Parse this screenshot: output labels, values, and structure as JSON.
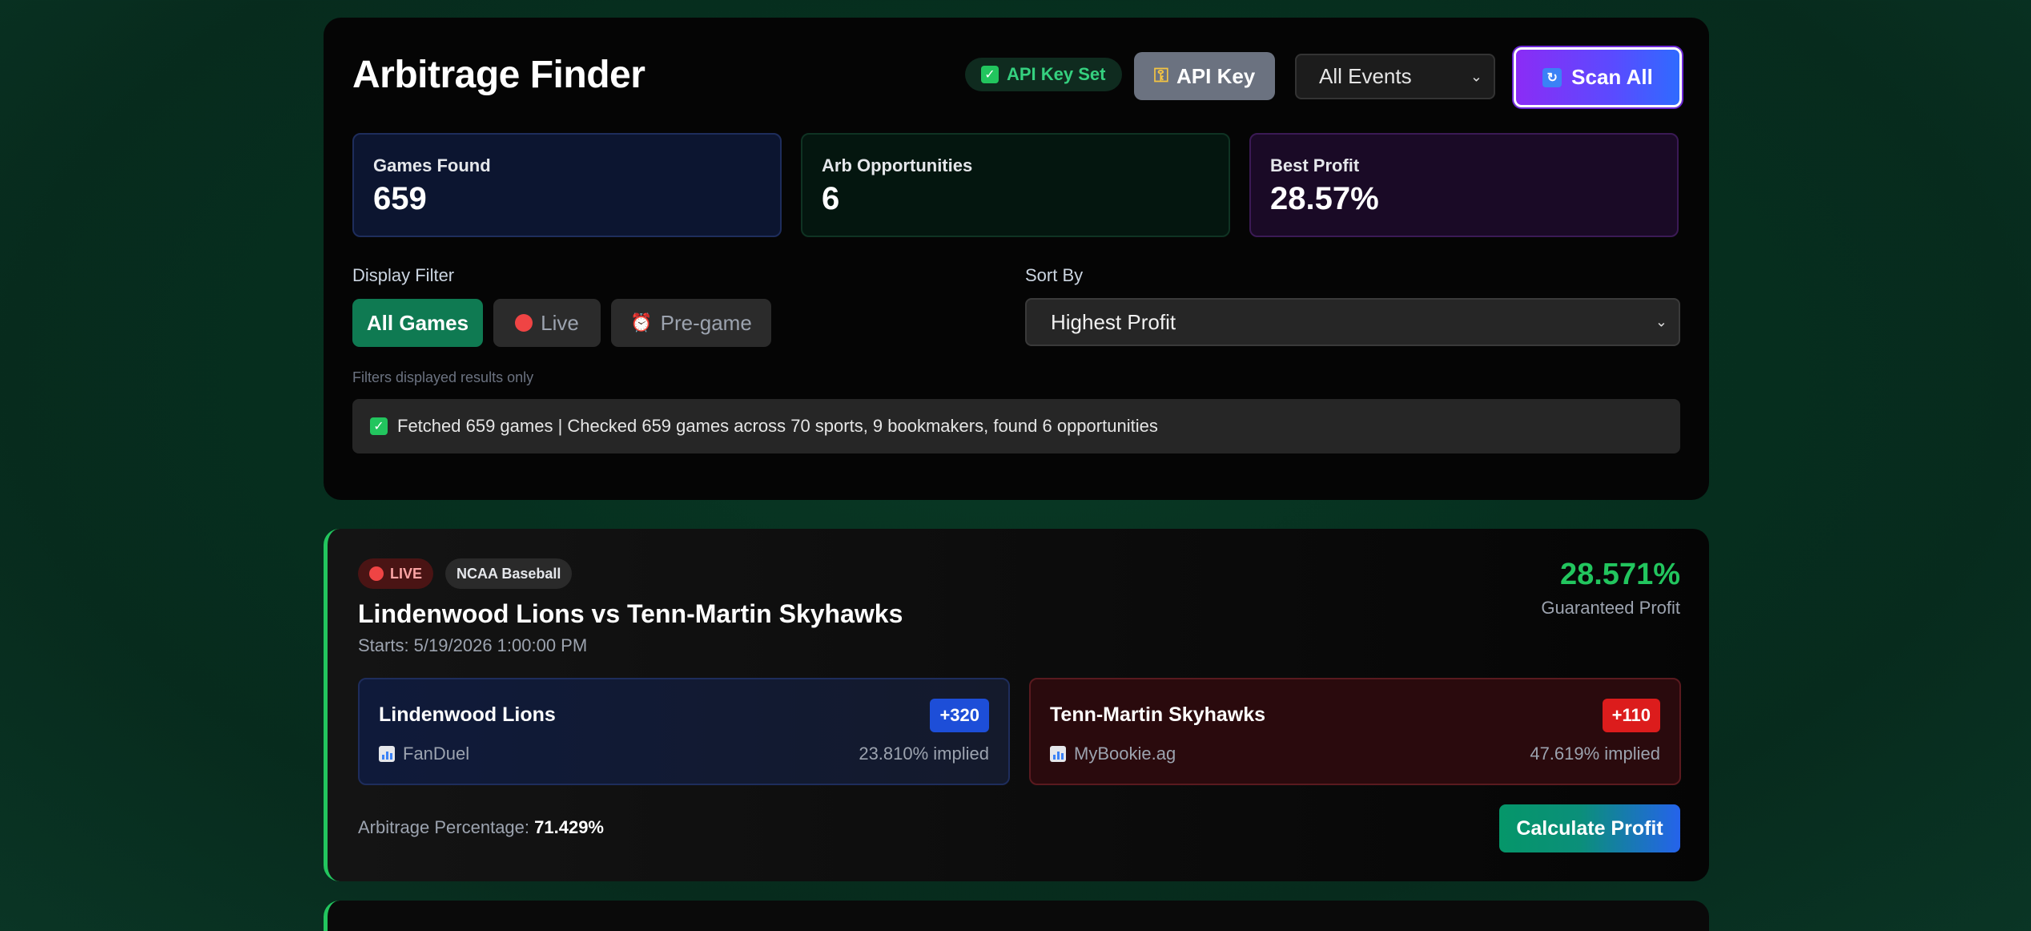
{
  "header": {
    "title": "Arbitrage Finder",
    "api_status": "API Key Set",
    "api_key_button": "API Key",
    "events_select": "All Events",
    "scan_button": "Scan All"
  },
  "stats": [
    {
      "label": "Games Found",
      "value": "659"
    },
    {
      "label": "Arb Opportunities",
      "value": "6"
    },
    {
      "label": "Best Profit",
      "value": "28.57%"
    }
  ],
  "filters": {
    "label": "Display Filter",
    "options": [
      "All Games",
      "Live",
      "Pre-game"
    ],
    "active": "All Games",
    "hint": "Filters displayed results only"
  },
  "sort": {
    "label": "Sort By",
    "selected": "Highest Profit"
  },
  "status_message": "Fetched 659 games | Checked 659 games across 70 sports, 9 bookmakers, found 6 opportunities",
  "opportunity": {
    "live_badge": "LIVE",
    "sport": "NCAA Baseball",
    "title": "Lindenwood Lions vs Tenn-Martin Skyhawks",
    "starts": "Starts: 5/19/2026 1:00:00 PM",
    "profit": "28.571%",
    "profit_label": "Guaranteed Profit",
    "outcomes": [
      {
        "team": "Lindenwood Lions",
        "odds": "+320",
        "book": "FanDuel",
        "implied": "23.810% implied"
      },
      {
        "team": "Tenn-Martin Skyhawks",
        "odds": "+110",
        "book": "MyBookie.ag",
        "implied": "47.619% implied"
      }
    ],
    "arb_label": "Arbitrage Percentage:",
    "arb_value": "71.429%",
    "calc_button": "Calculate Profit"
  },
  "colors": {
    "accent_green": "#22c55e",
    "scan_purple": "#8b2cf5",
    "odds_blue": "#1d4ed8",
    "odds_red": "#dc1c1c"
  },
  "icons": [
    "check-icon",
    "key-icon",
    "refresh-icon",
    "red-dot-icon",
    "alarm-clock-icon",
    "chart-icon"
  ]
}
